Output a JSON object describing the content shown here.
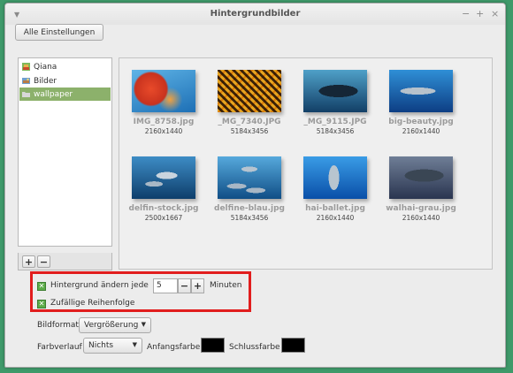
{
  "window": {
    "title": "Hintergrundbilder",
    "menu_icon": "chevron-down-icon",
    "controls": [
      "−",
      "+",
      "×"
    ]
  },
  "toolbar": {
    "all_settings": "Alle Einstellungen"
  },
  "sidebar": {
    "items": [
      {
        "label": "Qiana",
        "icon": "mint-logo-icon",
        "selected": false
      },
      {
        "label": "Bilder",
        "icon": "pictures-folder-icon",
        "selected": false
      },
      {
        "label": "wallpaper",
        "icon": "folder-icon",
        "selected": true
      }
    ],
    "add_label": "+",
    "remove_label": "−"
  },
  "images": [
    {
      "name": "IMG_8758.jpg",
      "size": "2160x1440",
      "scene": "red coral reef"
    },
    {
      "name": "_MG_7340.JPG",
      "size": "5184x3456",
      "scene": "golden sea fan"
    },
    {
      "name": "_MG_9115.JPG",
      "size": "5184x3456",
      "scene": "manta ray"
    },
    {
      "name": "big-beauty.jpg",
      "size": "2160x1440",
      "scene": "shark"
    },
    {
      "name": "delfin-stock.jpg",
      "size": "2500x1667",
      "scene": "dolphins"
    },
    {
      "name": "delfine-blau.jpg",
      "size": "5184x3456",
      "scene": "dolphin pod"
    },
    {
      "name": "hai-ballet.jpg",
      "size": "2160x1440",
      "scene": "shark ballet"
    },
    {
      "name": "walhai-grau.jpg",
      "size": "2160x1440",
      "scene": "whale shark"
    }
  ],
  "settings": {
    "change_every_label": "Hintergrund ändern jede",
    "change_every_value": "5",
    "minutes_label": "Minuten",
    "random_order_label": "Zufällige Reihenfolge",
    "change_every_checked": true,
    "random_order_checked": true,
    "picture_format_label": "Bildformat",
    "picture_format_value": "Vergrößerung",
    "gradient_label": "Farbverlauf",
    "gradient_value": "Nichts",
    "start_color_label": "Anfangsfarbe",
    "end_color_label": "Schlussfarbe",
    "start_color": "#000000",
    "end_color": "#000000"
  },
  "colors": {
    "selection": "#8cb16b",
    "highlight_box": "#e11d1d",
    "checkbox": "#5cab48",
    "desktop": "#3f9a6a"
  }
}
